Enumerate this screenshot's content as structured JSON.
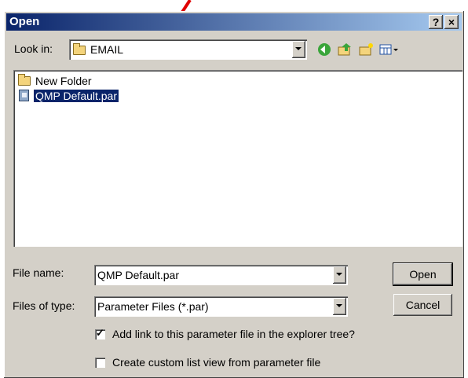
{
  "window": {
    "title": "Open",
    "help_btn": "?",
    "close_btn": "×"
  },
  "look_in": {
    "label": "Look in:",
    "value": "EMAIL"
  },
  "files": [
    {
      "name": "New Folder",
      "type": "folder",
      "selected": false
    },
    {
      "name": "QMP Default.par",
      "type": "par-file",
      "selected": true
    }
  ],
  "file_name": {
    "label": "File name:",
    "value": "QMP Default.par"
  },
  "file_type": {
    "label": "Files of type:",
    "value": "Parameter Files (*.par)"
  },
  "buttons": {
    "open": "Open",
    "cancel": "Cancel"
  },
  "checkboxes": [
    {
      "label": "Add link to this parameter file in the explorer tree?",
      "checked": true
    },
    {
      "label": "Create custom list view from parameter file",
      "checked": false
    }
  ],
  "toolbar_icons": [
    "back-icon",
    "up-folder-icon",
    "new-folder-icon",
    "view-menu-icon"
  ],
  "colors": {
    "titlebar_start": "#0a246a",
    "selection": "#0a246a",
    "annotation_arrow": "#e00000"
  }
}
